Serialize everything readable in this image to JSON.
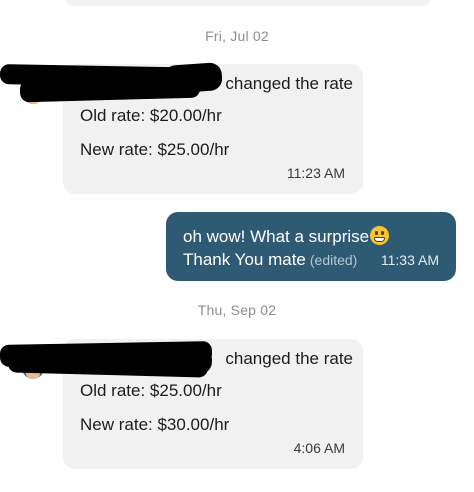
{
  "conversation": {
    "date_separators": [
      "Fri, Jul 02",
      "Thu, Sep 02"
    ],
    "messages": [
      {
        "direction": "incoming",
        "headline": "changed the rate",
        "old_rate": "Old rate: $20.00/hr",
        "new_rate": "New rate: $25.00/hr",
        "time": "11:23 AM"
      },
      {
        "direction": "outgoing",
        "line1": "oh wow! What a surprise",
        "emoji": "grinning-face-icon",
        "line2": "Thank You mate",
        "edited": "(edited)",
        "time": "11:33 AM"
      },
      {
        "direction": "incoming",
        "headline": "changed the rate",
        "old_rate": "Old rate: $25.00/hr",
        "new_rate": "New rate: $30.00/hr",
        "time": "4:06 AM"
      }
    ]
  },
  "colors": {
    "incoming_bubble": "#f1f1f2",
    "outgoing_bubble": "#2f5a73",
    "date_text": "#8e8e93",
    "redaction": "#000000"
  }
}
